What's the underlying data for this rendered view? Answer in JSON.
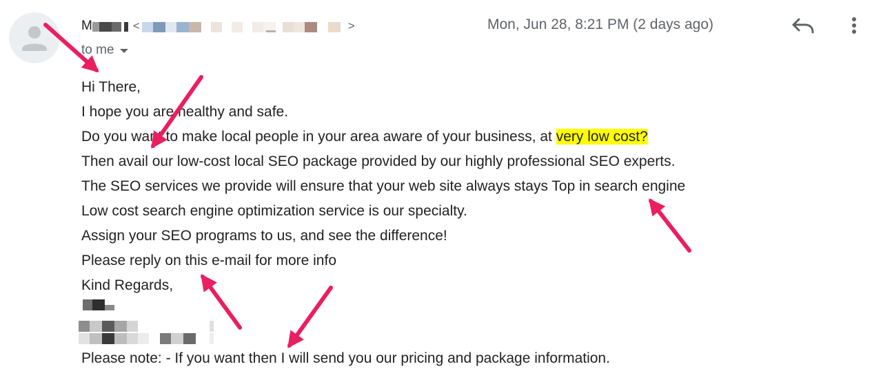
{
  "header": {
    "sender_redacted": "M",
    "recipient_label": "to me",
    "date": "Mon, Jun 28, 8:21 PM (2 days ago)"
  },
  "icons": {
    "avatar": "person-icon",
    "reply": "reply-icon",
    "more": "more-vert-icon",
    "recipient_toggle": "chevron-down-icon"
  },
  "body": {
    "lines": [
      "Hi There,",
      "I hope you are healthy and safe.",
      "Do you want to make local people in your area aware of your business, at ",
      "Then avail our low-cost local SEO package provided by our highly professional SEO experts.",
      "The SEO services we provide will ensure that your web site always stays Top in search engine",
      "Low cost search engine optimization service is our specialty.",
      "Assign your SEO programs to us, and see the difference!",
      "Please reply on this e-mail for more info",
      "Kind Regards,"
    ],
    "highlight": "very low cost?",
    "note": "Please note: - If you want then I will send you our pricing and package information."
  },
  "colors": {
    "annotation_arrow": "#ea1f5f",
    "highlight": "#ffff00"
  }
}
